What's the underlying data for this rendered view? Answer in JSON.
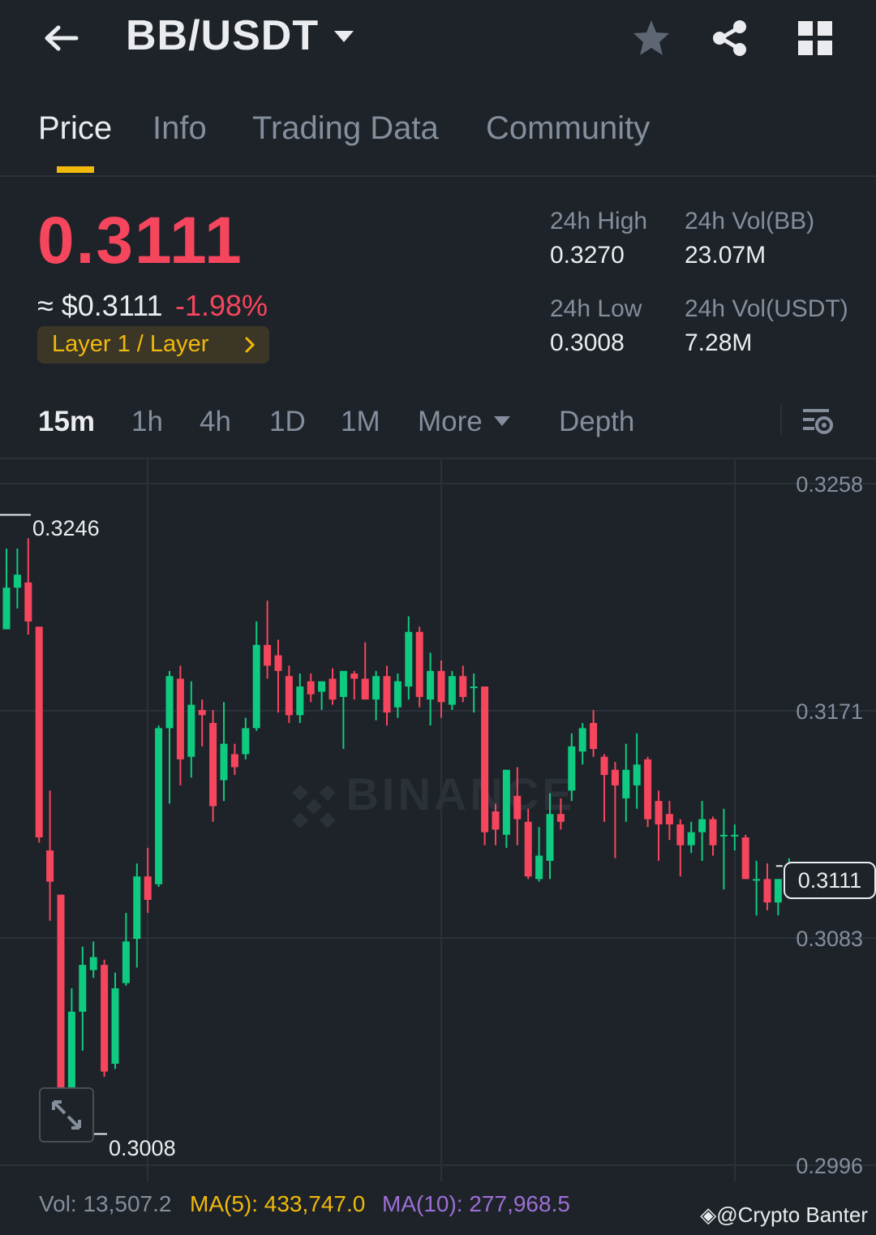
{
  "header": {
    "pair": "BB/USDT",
    "icons": [
      "back-arrow-icon",
      "caret-down-icon",
      "star-icon",
      "share-icon",
      "grid-icon"
    ]
  },
  "tabs": [
    {
      "label": "Price",
      "active": true
    },
    {
      "label": "Info",
      "active": false
    },
    {
      "label": "Trading Data",
      "active": false
    },
    {
      "label": "Community",
      "active": false
    }
  ],
  "price": {
    "last": "0.3111",
    "usd": "≈ $0.3111",
    "change": "-1.98%",
    "tag": "Layer 1 / Layer",
    "stats": {
      "high_label": "24h High",
      "high_value": "0.3270",
      "low_label": "24h Low",
      "low_value": "0.3008",
      "vol_base_label": "24h Vol(BB)",
      "vol_base_value": "23.07M",
      "vol_quote_label": "24h Vol(USDT)",
      "vol_quote_value": "7.28M"
    }
  },
  "intervals": {
    "items": [
      "15m",
      "1h",
      "4h",
      "1D",
      "1M"
    ],
    "active": "15m",
    "more": "More",
    "depth": "Depth"
  },
  "chart": {
    "y_ticks": [
      "0.3258",
      "0.3171",
      "0.3083",
      "0.2996"
    ],
    "last_price_tag": "0.3111",
    "max_label": "0.3246",
    "min_label": "0.3008",
    "watermark": "BINANCE",
    "up_color": "#0ecb81",
    "down_color": "#f6465d"
  },
  "chart_data": {
    "type": "candlestick",
    "interval": "15m",
    "ylim": [
      0.2996,
      0.3258
    ],
    "grid": true,
    "candles": [
      {
        "o": 0.3202,
        "h": 0.3233,
        "l": 0.3202,
        "c": 0.3218
      },
      {
        "o": 0.3218,
        "h": 0.3233,
        "l": 0.321,
        "c": 0.3223
      },
      {
        "o": 0.322,
        "h": 0.3237,
        "l": 0.32,
        "c": 0.3205
      },
      {
        "o": 0.3203,
        "h": 0.3203,
        "l": 0.312,
        "c": 0.3122
      },
      {
        "o": 0.3117,
        "h": 0.314,
        "l": 0.309,
        "c": 0.3105
      },
      {
        "o": 0.31,
        "h": 0.31,
        "l": 0.3012,
        "c": 0.3015
      },
      {
        "o": 0.3015,
        "h": 0.3064,
        "l": 0.3008,
        "c": 0.3055
      },
      {
        "o": 0.3055,
        "h": 0.308,
        "l": 0.304,
        "c": 0.3073
      },
      {
        "o": 0.3071,
        "h": 0.3082,
        "l": 0.3068,
        "c": 0.3076
      },
      {
        "o": 0.3073,
        "h": 0.3075,
        "l": 0.303,
        "c": 0.3032
      },
      {
        "o": 0.3035,
        "h": 0.307,
        "l": 0.3033,
        "c": 0.3064
      },
      {
        "o": 0.3066,
        "h": 0.3093,
        "l": 0.3065,
        "c": 0.3082
      },
      {
        "o": 0.3083,
        "h": 0.3112,
        "l": 0.3072,
        "c": 0.3107
      },
      {
        "o": 0.3107,
        "h": 0.3118,
        "l": 0.3093,
        "c": 0.3098
      },
      {
        "o": 0.3104,
        "h": 0.3165,
        "l": 0.3103,
        "c": 0.3164
      },
      {
        "o": 0.3164,
        "h": 0.3186,
        "l": 0.3135,
        "c": 0.3184
      },
      {
        "o": 0.3183,
        "h": 0.3188,
        "l": 0.3142,
        "c": 0.3152
      },
      {
        "o": 0.3153,
        "h": 0.3182,
        "l": 0.3145,
        "c": 0.3173
      },
      {
        "o": 0.3171,
        "h": 0.3175,
        "l": 0.3157,
        "c": 0.3169
      },
      {
        "o": 0.3166,
        "h": 0.3171,
        "l": 0.3128,
        "c": 0.3134
      },
      {
        "o": 0.3144,
        "h": 0.3174,
        "l": 0.3136,
        "c": 0.3158
      },
      {
        "o": 0.3154,
        "h": 0.3158,
        "l": 0.3146,
        "c": 0.3149
      },
      {
        "o": 0.3154,
        "h": 0.3168,
        "l": 0.3152,
        "c": 0.3164
      },
      {
        "o": 0.3164,
        "h": 0.3205,
        "l": 0.3163,
        "c": 0.3196
      },
      {
        "o": 0.3196,
        "h": 0.3213,
        "l": 0.3183,
        "c": 0.3188
      },
      {
        "o": 0.3192,
        "h": 0.3198,
        "l": 0.317,
        "c": 0.3186
      },
      {
        "o": 0.3184,
        "h": 0.3188,
        "l": 0.3166,
        "c": 0.3169
      },
      {
        "o": 0.3169,
        "h": 0.3185,
        "l": 0.3166,
        "c": 0.318
      },
      {
        "o": 0.3182,
        "h": 0.3185,
        "l": 0.3174,
        "c": 0.3177
      },
      {
        "o": 0.3178,
        "h": 0.3182,
        "l": 0.3171,
        "c": 0.3182
      },
      {
        "o": 0.3183,
        "h": 0.3187,
        "l": 0.3173,
        "c": 0.3175
      },
      {
        "o": 0.3176,
        "h": 0.3186,
        "l": 0.3156,
        "c": 0.3186
      },
      {
        "o": 0.3185,
        "h": 0.3186,
        "l": 0.3175,
        "c": 0.3183
      },
      {
        "o": 0.3183,
        "h": 0.3197,
        "l": 0.3175,
        "c": 0.3175
      },
      {
        "o": 0.3175,
        "h": 0.3186,
        "l": 0.3167,
        "c": 0.3184
      },
      {
        "o": 0.3184,
        "h": 0.3188,
        "l": 0.3165,
        "c": 0.317
      },
      {
        "o": 0.3172,
        "h": 0.3185,
        "l": 0.3168,
        "c": 0.3182
      },
      {
        "o": 0.318,
        "h": 0.3207,
        "l": 0.3175,
        "c": 0.3201
      },
      {
        "o": 0.3201,
        "h": 0.3203,
        "l": 0.3172,
        "c": 0.3176
      },
      {
        "o": 0.3175,
        "h": 0.3193,
        "l": 0.3165,
        "c": 0.3186
      },
      {
        "o": 0.3186,
        "h": 0.319,
        "l": 0.3168,
        "c": 0.3174
      },
      {
        "o": 0.3173,
        "h": 0.3186,
        "l": 0.3171,
        "c": 0.3184
      },
      {
        "o": 0.3184,
        "h": 0.3188,
        "l": 0.3174,
        "c": 0.3176
      },
      {
        "o": 0.318,
        "h": 0.3185,
        "l": 0.317,
        "c": 0.318
      },
      {
        "o": 0.318,
        "h": 0.318,
        "l": 0.3119,
        "c": 0.3124
      },
      {
        "o": 0.3132,
        "h": 0.3135,
        "l": 0.3119,
        "c": 0.3125
      },
      {
        "o": 0.3123,
        "h": 0.3148,
        "l": 0.3118,
        "c": 0.3148
      },
      {
        "o": 0.3138,
        "h": 0.3149,
        "l": 0.3119,
        "c": 0.3129
      },
      {
        "o": 0.3128,
        "h": 0.3133,
        "l": 0.3106,
        "c": 0.3107
      },
      {
        "o": 0.3106,
        "h": 0.3126,
        "l": 0.3105,
        "c": 0.3115
      },
      {
        "o": 0.3113,
        "h": 0.3139,
        "l": 0.3106,
        "c": 0.3131
      },
      {
        "o": 0.3131,
        "h": 0.3137,
        "l": 0.3125,
        "c": 0.3128
      },
      {
        "o": 0.314,
        "h": 0.3162,
        "l": 0.3136,
        "c": 0.3157
      },
      {
        "o": 0.3155,
        "h": 0.3166,
        "l": 0.315,
        "c": 0.3164
      },
      {
        "o": 0.3166,
        "h": 0.3171,
        "l": 0.3153,
        "c": 0.3156
      },
      {
        "o": 0.3153,
        "h": 0.3154,
        "l": 0.3128,
        "c": 0.3146
      },
      {
        "o": 0.3148,
        "h": 0.3151,
        "l": 0.3114,
        "c": 0.3142
      },
      {
        "o": 0.3137,
        "h": 0.3158,
        "l": 0.3128,
        "c": 0.3148
      },
      {
        "o": 0.3142,
        "h": 0.3162,
        "l": 0.3133,
        "c": 0.315
      },
      {
        "o": 0.3152,
        "h": 0.3153,
        "l": 0.3126,
        "c": 0.3129
      },
      {
        "o": 0.3136,
        "h": 0.314,
        "l": 0.3113,
        "c": 0.3127
      },
      {
        "o": 0.3131,
        "h": 0.3136,
        "l": 0.3121,
        "c": 0.3127
      },
      {
        "o": 0.3127,
        "h": 0.3129,
        "l": 0.3107,
        "c": 0.3119
      },
      {
        "o": 0.3119,
        "h": 0.3128,
        "l": 0.3116,
        "c": 0.3124
      },
      {
        "o": 0.3124,
        "h": 0.3136,
        "l": 0.3113,
        "c": 0.3129
      },
      {
        "o": 0.3129,
        "h": 0.313,
        "l": 0.3115,
        "c": 0.3119
      },
      {
        "o": 0.3123,
        "h": 0.3133,
        "l": 0.3102,
        "c": 0.3123
      },
      {
        "o": 0.3123,
        "h": 0.3127,
        "l": 0.3117,
        "c": 0.3123
      },
      {
        "o": 0.3122,
        "h": 0.3123,
        "l": 0.3106,
        "c": 0.3106
      },
      {
        "o": 0.3106,
        "h": 0.3113,
        "l": 0.3092,
        "c": 0.3106
      },
      {
        "o": 0.3106,
        "h": 0.3112,
        "l": 0.3094,
        "c": 0.3097
      },
      {
        "o": 0.3097,
        "h": 0.3106,
        "l": 0.3092,
        "c": 0.3106
      },
      {
        "o": 0.3108,
        "h": 0.3114,
        "l": 0.31,
        "c": 0.3111
      }
    ],
    "ma": [
      {
        "name": "MA(5)",
        "value": "433,747.0"
      },
      {
        "name": "MA(10)",
        "value": "277,968.5"
      }
    ],
    "volume": "13,507.2"
  },
  "footer": {
    "vol": "Vol: 13,507.2",
    "ma5": "MA(5): 433,747.0",
    "ma10": "MA(10): 277,968.5",
    "ma5_color": "#f0b90b",
    "ma10_color": "#9c6fd6",
    "credit": "@Crypto Banter"
  }
}
